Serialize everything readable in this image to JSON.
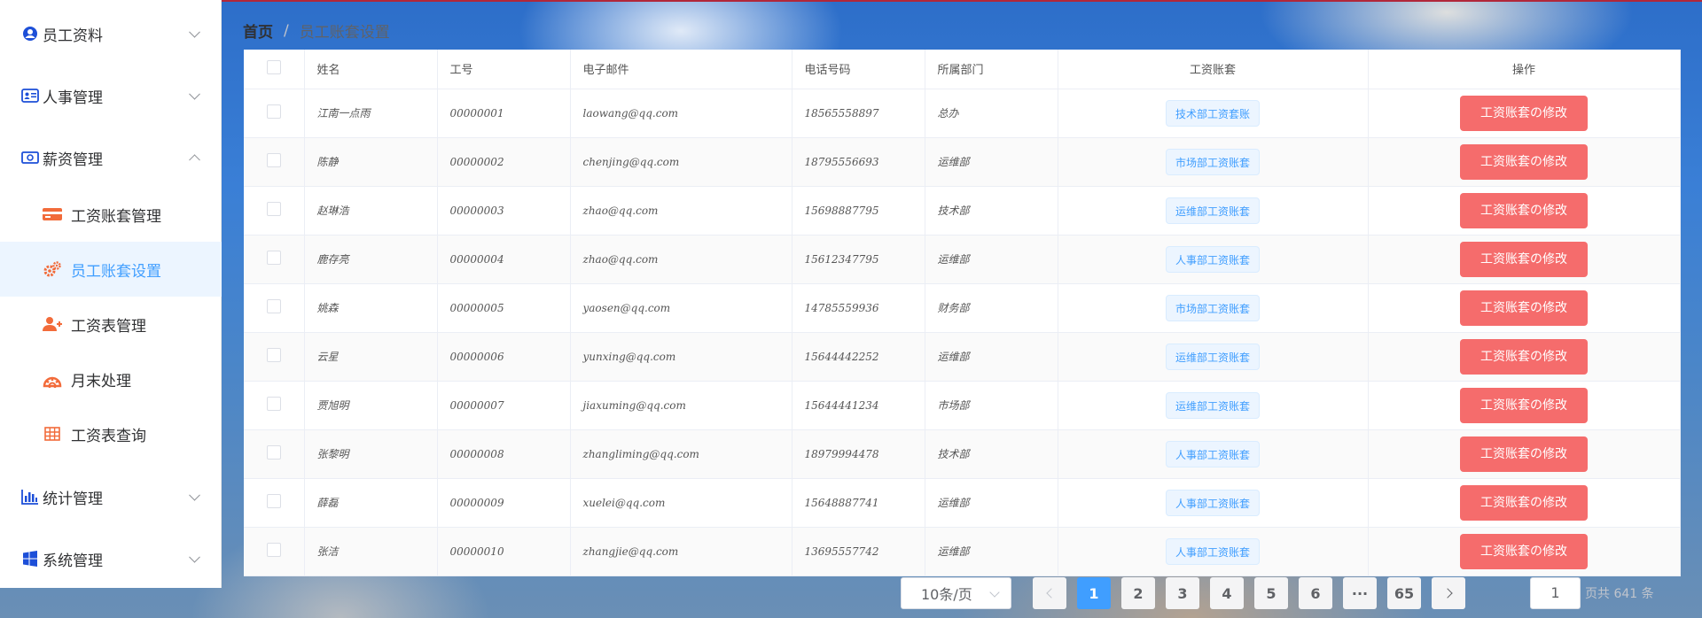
{
  "sidebar": {
    "items": [
      {
        "label": "员工资料",
        "expanded": false
      },
      {
        "label": "人事管理",
        "expanded": false
      },
      {
        "label": "薪资管理",
        "expanded": true
      },
      {
        "label": "统计管理",
        "expanded": false
      },
      {
        "label": "系统管理",
        "expanded": false
      }
    ],
    "sub_items": [
      {
        "label": "工资账套管理",
        "icon": "credit-card-icon"
      },
      {
        "label": "员工账套设置",
        "icon": "gears-icon",
        "active": true
      },
      {
        "label": "工资表管理",
        "icon": "user-plus-icon"
      },
      {
        "label": "月末处理",
        "icon": "life-ring-icon"
      },
      {
        "label": "工资表查询",
        "icon": "table-icon"
      }
    ]
  },
  "breadcrumb": {
    "home": "首页",
    "separator": "/",
    "current": "员工账套设置"
  },
  "table": {
    "headers": {
      "name": "姓名",
      "work_id": "工号",
      "email": "电子邮件",
      "phone": "电话号码",
      "department": "所属部门",
      "salary_set": "工资账套",
      "actions": "操作"
    },
    "rows": [
      {
        "name": "江南一点雨",
        "work_id": "00000001",
        "email": "laowang@qq.com",
        "phone": "18565558897",
        "department": "总办",
        "salary_set": "技术部工资套账",
        "action": "工资账套の修改"
      },
      {
        "name": "陈静",
        "work_id": "00000002",
        "email": "chenjing@qq.com",
        "phone": "18795556693",
        "department": "运维部",
        "salary_set": "市场部工资账套",
        "action": "工资账套の修改"
      },
      {
        "name": "赵琳浩",
        "work_id": "00000003",
        "email": "zhao@qq.com",
        "phone": "15698887795",
        "department": "技术部",
        "salary_set": "运维部工资账套",
        "action": "工资账套の修改"
      },
      {
        "name": "鹿存亮",
        "work_id": "00000004",
        "email": "zhao@qq.com",
        "phone": "15612347795",
        "department": "运维部",
        "salary_set": "人事部工资账套",
        "action": "工资账套の修改"
      },
      {
        "name": "姚森",
        "work_id": "00000005",
        "email": "yaosen@qq.com",
        "phone": "14785559936",
        "department": "财务部",
        "salary_set": "市场部工资账套",
        "action": "工资账套の修改"
      },
      {
        "name": "云星",
        "work_id": "00000006",
        "email": "yunxing@qq.com",
        "phone": "15644442252",
        "department": "运维部",
        "salary_set": "运维部工资账套",
        "action": "工资账套の修改"
      },
      {
        "name": "贾旭明",
        "work_id": "00000007",
        "email": "jiaxuming@qq.com",
        "phone": "15644441234",
        "department": "市场部",
        "salary_set": "运维部工资账套",
        "action": "工资账套の修改"
      },
      {
        "name": "张黎明",
        "work_id": "00000008",
        "email": "zhangliming@qq.com",
        "phone": "18979994478",
        "department": "技术部",
        "salary_set": "人事部工资账套",
        "action": "工资账套の修改"
      },
      {
        "name": "薛磊",
        "work_id": "00000009",
        "email": "xuelei@qq.com",
        "phone": "15648887741",
        "department": "运维部",
        "salary_set": "人事部工资账套",
        "action": "工资账套の修改"
      },
      {
        "name": "张洁",
        "work_id": "00000010",
        "email": "zhangjie@qq.com",
        "phone": "13695557742",
        "department": "运维部",
        "salary_set": "人事部工资账套",
        "action": "工资账套の修改"
      }
    ]
  },
  "pagination": {
    "page_size": "10条/页",
    "pages": [
      "1",
      "2",
      "3",
      "4",
      "5",
      "6",
      "···",
      "65"
    ],
    "current_page": "1",
    "jump_value": "1",
    "total_text": "页共 641 条"
  },
  "colors": {
    "accent": "#409eff",
    "danger": "#f56c6c",
    "tag_bg": "#ecf5ff"
  }
}
